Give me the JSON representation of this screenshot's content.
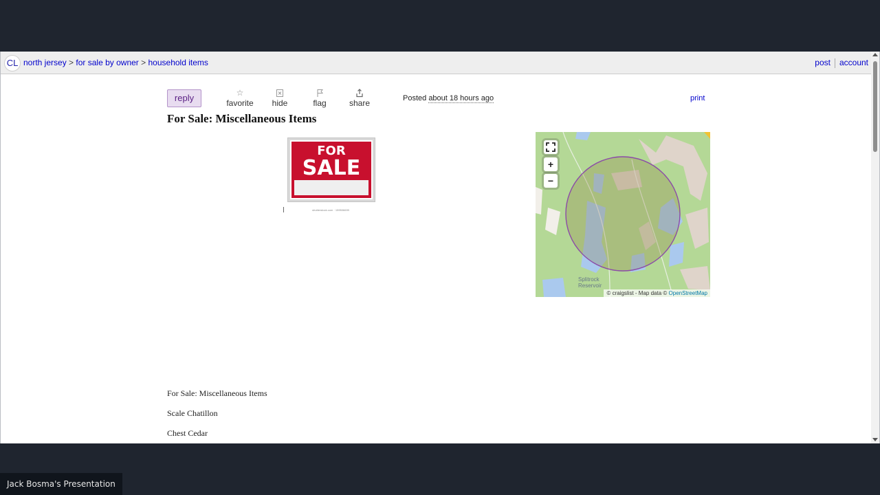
{
  "header": {
    "logo": "CL",
    "breadcrumbs": [
      "north jersey",
      "for sale by owner",
      "household items"
    ],
    "separator": ">",
    "post_link": "post",
    "account_link": "account"
  },
  "actions": {
    "reply": "reply",
    "favorite": "favorite",
    "hide": "hide",
    "flag": "flag",
    "share": "share"
  },
  "posted": {
    "label": "Posted",
    "time": "about 18 hours ago"
  },
  "print_label": "print",
  "listing": {
    "title": "For Sale: Miscellaneous Items",
    "image": {
      "line1": "FOR",
      "line2": "SALE",
      "credit": "shutterstock.com · 159506699"
    },
    "body": [
      "For Sale: Miscellaneous Items",
      "Scale Chatillon",
      "Chest Cedar"
    ]
  },
  "map": {
    "label_line1": "Splitrock",
    "label_line2": "Reservoir",
    "attribution": "© craigslist - Map data ©",
    "attribution_link": "OpenStreetMap",
    "fullscreen_icon": "fullscreen-icon",
    "zoom_in": "+",
    "zoom_out": "−"
  },
  "presenter": "Jack Bosma's Presentation",
  "colors": {
    "link": "#0000cc",
    "reply_bg": "#e8dcf0",
    "reply_text": "#5a1f84",
    "sign_red": "#c8102e",
    "map_land": "#b4d896",
    "map_water": "#aac9ee",
    "radius_circle": "#8b4aa8",
    "frame_bg": "#1f252f"
  }
}
